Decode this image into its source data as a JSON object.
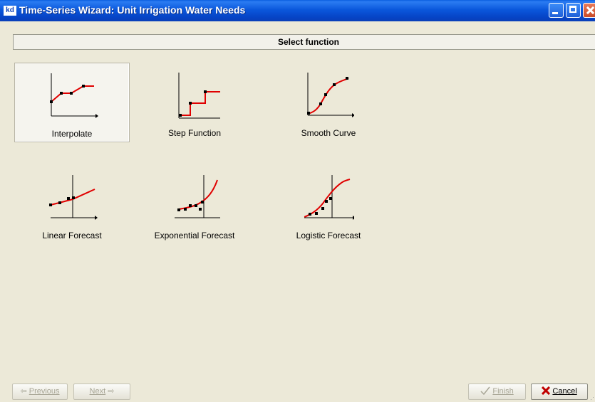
{
  "window": {
    "title": "Time-Series Wizard: Unit Irrigation Water Needs",
    "icon_label": "kd"
  },
  "header": {
    "title": "Select function"
  },
  "functions": [
    {
      "label": "Interpolate",
      "icon": "interpolate-graph-icon",
      "selected": true
    },
    {
      "label": "Step Function",
      "icon": "step-function-graph-icon",
      "selected": false
    },
    {
      "label": "Smooth Curve",
      "icon": "smooth-curve-graph-icon",
      "selected": false
    },
    {
      "label": "Linear Forecast",
      "icon": "linear-forecast-graph-icon",
      "selected": false
    },
    {
      "label": "Exponential Forecast",
      "icon": "exponential-forecast-graph-icon",
      "selected": false
    },
    {
      "label": "Logistic Forecast",
      "icon": "logistic-forecast-graph-icon",
      "selected": false
    }
  ],
  "buttons": {
    "previous": {
      "label": "Previous",
      "arrow": "⇦",
      "enabled": false
    },
    "next": {
      "label": "Next",
      "arrow": "⇨",
      "enabled": false
    },
    "finish": {
      "label": "Finish",
      "enabled": false
    },
    "cancel": {
      "label": "Cancel",
      "enabled": true
    }
  },
  "colors": {
    "curve": "#e00000",
    "title_bar": "#0a5fe0",
    "cancel_x": "#c00000"
  }
}
